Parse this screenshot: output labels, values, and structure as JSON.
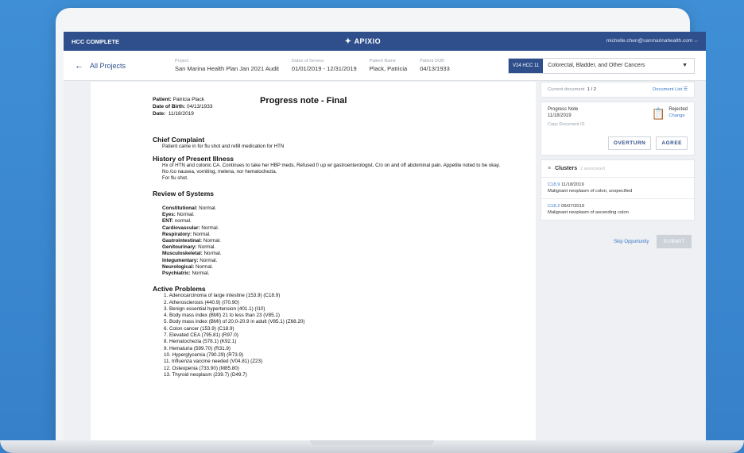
{
  "topbar": {
    "product": "HCC COMPLETE",
    "logo": "APIXIO",
    "user": "michelle.chen@sanmarinahealth.com"
  },
  "infobar": {
    "back_label": "All Projects",
    "project": {
      "label": "Project",
      "value": "San Marina Health Plan Jan 2021 Audit"
    },
    "dos": {
      "label": "Dates of Service",
      "value": "01/01/2019 - 12/31/2019"
    },
    "patient": {
      "label": "Patient Name",
      "value": "Plack, Patricia"
    },
    "dob": {
      "label": "Patient DOB",
      "value": "04/13/1933"
    },
    "hcc_tag": "V24 HCC 11",
    "hcc_value": "Colorectal, Bladder, and Other Cancers"
  },
  "document": {
    "patient": "Patricia Plack",
    "dob": "04/13/1933",
    "date": "11/18/2019",
    "title": "Progress note - Final",
    "chief_complaint_h": "Chief Complaint",
    "chief_complaint": "Patient came in for flu shot and refill medication for HTN",
    "hpi_h": "History of Present Illness",
    "hpi_1": "Hx of HTN and colonic CA. Continues to take her HBP meds. Refused f/ up w/ gastroenterologist. C/o on and off abdominal pain. Appetite noted to be okay. No /co nausea, vomiting, melena, nor hematochezia.",
    "hpi_2": "For flu shot.",
    "ros_h": "Review of Systems",
    "ros": [
      {
        "k": "Constitutional:",
        "v": "Normal."
      },
      {
        "k": "Eyes:",
        "v": "Normal."
      },
      {
        "k": "ENT:",
        "v": "normal."
      },
      {
        "k": "Cardiovascular:",
        "v": "Normal."
      },
      {
        "k": "Respiratory:",
        "v": "Normal."
      },
      {
        "k": "Gastrointestinal:",
        "v": "Normal."
      },
      {
        "k": "Genitourinary:",
        "v": "Normal."
      },
      {
        "k": "Musculoskeletal:",
        "v": "Normal."
      },
      {
        "k": "Integumentary:",
        "v": "Normal."
      },
      {
        "k": "Neurological:",
        "v": "Normal."
      },
      {
        "k": "Psychiatric:",
        "v": "Normal."
      }
    ],
    "problems_h": "Active Problems",
    "problems": [
      "1. Adenocarcinoma of large intestine (153.9) (C18.9)",
      "2. Atherosclerosis (440.9) (I70.90)",
      "3. Benign essential hypertension (401.1) (I10)",
      "4. Body mass index (BMI) 21 to less than 23 (V85.1)",
      "5. Body mass index (BMI) of 20.0-20.9 in adult (V85.1) (Z68.20)",
      "6. Colon cancer (153.9) (C18.9)",
      "7. Elevated CEA (795.81) (R97.0)",
      "8. Hematochezia (578.1) (K92.1)",
      "9. Hematuria (599.70) (R31.9)",
      "10. Hyperglycemia (790.29) (R73.9)",
      "11. Influenza vaccine needed (V04.81) (Z23)",
      "12. Osteopenia (733.90) (M85.80)",
      "13. Thyroid neoplasm (239.7) (D49.7)"
    ]
  },
  "panel": {
    "current_doc_label": "Current document",
    "current_doc_pos": "1 / 2",
    "doc_list": "Document List",
    "note_title": "Progress Note",
    "note_date": "11/18/2019",
    "copy_id": "Copy Document ID",
    "status": "Rejected",
    "change": "Change",
    "overturn": "OVERTURN",
    "agree": "AGREE",
    "clusters_label": "Clusters",
    "clusters_count": "2 associated",
    "clusters": [
      {
        "code": "C18.9",
        "date": "11/18/2019",
        "desc": "Malignant neoplasm of colon, unspecified"
      },
      {
        "code": "C18.2",
        "date": "06/07/2019",
        "desc": "Malignant neoplasm of ascending colon"
      }
    ],
    "skip": "Skip Opportunity",
    "submit": "SUBMIT"
  }
}
